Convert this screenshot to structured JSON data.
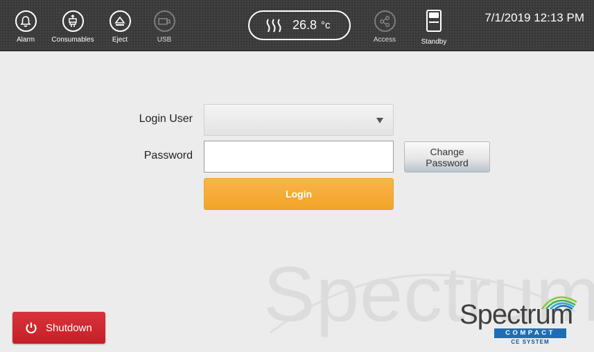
{
  "toolbar": {
    "alarm_label": "Alarm",
    "consumables_label": "Consumables",
    "eject_label": "Eject",
    "usb_label": "USB",
    "temperature_value": "26.8",
    "temperature_unit": "°c",
    "access_label": "Access",
    "standby_label": "Standby",
    "datetime": "7/1/2019 12:13 PM"
  },
  "login": {
    "user_label": "Login User",
    "user_value": "",
    "password_label": "Password",
    "password_value": "",
    "change_password_line1": "Change",
    "change_password_line2": "Password",
    "login_button": "Login"
  },
  "shutdown_label": "Shutdown",
  "logo": {
    "word": "Spectrum",
    "compact": "COMPACT",
    "subtitle": "CE SYSTEM"
  },
  "watermark": "Spectrum",
  "colors": {
    "toolbar_bg": "#3a3a3a",
    "login_orange": "#f2a427",
    "shutdown_red": "#c42027",
    "brand_blue": "#1d6fb4",
    "background": "#ececec"
  },
  "icons": [
    "bell-icon",
    "consumables-icon",
    "eject-icon",
    "usb-icon",
    "heater-icon",
    "share-icon",
    "standby-icon",
    "power-icon"
  ]
}
